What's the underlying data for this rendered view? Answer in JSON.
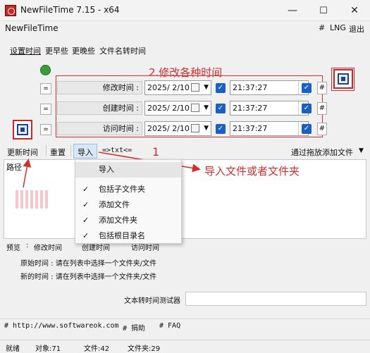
{
  "window": {
    "title": "NewFileTime 7.15 - x64",
    "minimize": "—",
    "maximize": "☐",
    "close": "✕"
  },
  "menubar": {
    "app_name": "NewFileTime",
    "hash": "#",
    "lng": "LNG",
    "exit": "退出"
  },
  "tabs": [
    "设置时间",
    "更早些",
    "更晚些",
    "文件名转时间"
  ],
  "rows": [
    {
      "eq": "=",
      "label": "修改时间 :",
      "date": "2025/ 2/10",
      "time": "21:37:27",
      "hash": "#"
    },
    {
      "eq": "=",
      "label": "创建时间 :",
      "date": "2025/ 2/10",
      "time": "21:37:27",
      "hash": "#"
    },
    {
      "eq": "=",
      "label": "访问时间 :",
      "date": "2025/ 2/10",
      "time": "21:37:27",
      "hash": "#"
    }
  ],
  "annotations": {
    "title": "2.修改各种时间",
    "one": "1",
    "import": "导入文件或者文件夹"
  },
  "toolbar": {
    "refresh": "更新时间",
    "reset": "重置",
    "import": "导入",
    "txt": "=>txt<=",
    "drop_add": "通过拖放添加文件",
    "drop_arrow": "▼"
  },
  "list": {
    "header": "路径"
  },
  "import_menu": [
    {
      "label": "导入",
      "checked": false
    },
    {
      "label": "包括子文件夹",
      "checked": true
    },
    {
      "label": "添加文件",
      "checked": true
    },
    {
      "label": "添加文件夹",
      "checked": true
    },
    {
      "label": "包括根目录名",
      "checked": true
    }
  ],
  "check_mark": "✓",
  "preview": {
    "label": "预览",
    "sep": ":",
    "modified": "修改时间",
    "created": "创建时间",
    "accessed": "访问时间"
  },
  "info": {
    "original": "原始时间 : 请在列表中选择一个文件夹/文件",
    "new": "新的时间 : 请在列表中选择一个文件夹/文件"
  },
  "tester": {
    "label": "文本转时间测试器",
    "value": ""
  },
  "links": {
    "url": "# http://www.softwareok.com",
    "donate": "# 捐助",
    "faq": "# FAQ"
  },
  "status": {
    "ready": "就绪",
    "objects": "对象:71",
    "files": "文件:42",
    "folders": "文件夹:29"
  },
  "colors": {
    "annotation_red": "#d32f2f",
    "check_blue": "#1a5fc4"
  }
}
